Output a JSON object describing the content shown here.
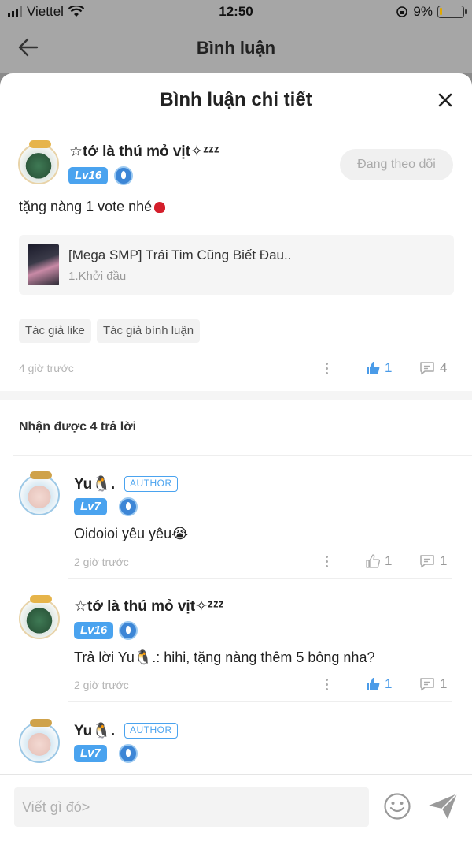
{
  "status_bar": {
    "carrier": "Viettel",
    "time": "12:50",
    "battery": "9%",
    "battery_level": 0.09
  },
  "background_header": {
    "title": "Bình luận"
  },
  "sheet": {
    "title": "Bình luận chi tiết"
  },
  "main_comment": {
    "username": "☆tớ là thú mỏ vịt✧ᶻᶻᶻ",
    "level": "Lv16",
    "follow_label": "Đang theo dõi",
    "text": "tặng nàng 1 vote nhé",
    "book": {
      "title": "[Mega SMP] Trái Tim Cũng Biết Đau..",
      "chapter": "1.Khởi đầu"
    },
    "chips": [
      "Tác giả like",
      "Tác giả bình luận"
    ],
    "time": "4 giờ trước",
    "likes": "1",
    "replies": "4"
  },
  "replies_header": "Nhận được 4 trả lời",
  "replies": [
    {
      "username": "Yu🐧.",
      "author_tag": "AUTHOR",
      "level": "Lv7",
      "text": "Oidoioi yêu yêu😭",
      "time": "2 giờ trước",
      "likes": "1",
      "replies": "1"
    },
    {
      "username": "☆tớ là thú mỏ vịt✧ᶻᶻᶻ",
      "level": "Lv16",
      "text": "Trả lời Yu🐧.: hihi, tặng nàng thêm 5 bông nha?",
      "time": "2 giờ trước",
      "likes": "1",
      "replies": "1"
    },
    {
      "username": "Yu🐧.",
      "author_tag": "AUTHOR",
      "level": "Lv7"
    }
  ],
  "composer": {
    "placeholder": "Viết gì đó>"
  },
  "colors": {
    "accent": "#4aa3ef",
    "liked": "#4a9be8"
  }
}
